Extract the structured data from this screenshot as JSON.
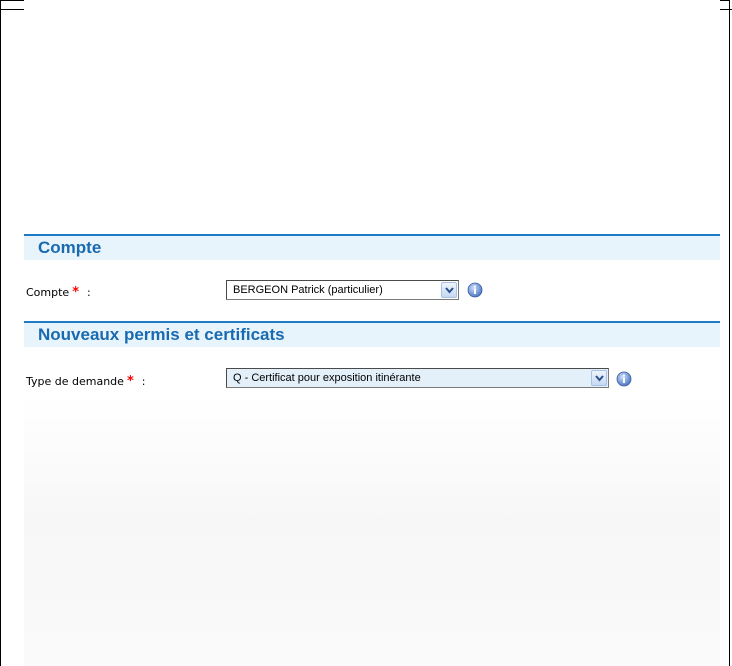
{
  "sections": {
    "compte": {
      "title": "Compte",
      "field_label": "Compte",
      "required_marker": "*",
      "colon": ":",
      "select_value": "BERGEON Patrick (particulier)"
    },
    "permis": {
      "title": "Nouveaux permis et certificats",
      "field_label": "Type de demande",
      "required_marker": "*",
      "colon": ":",
      "select_value": "Q - Certificat pour exposition itinérante"
    }
  },
  "icons": {
    "dropdown": "chevron-down-icon",
    "info": "info-icon"
  },
  "colors": {
    "accent": "#1a6aaf",
    "section_bg": "#e8f4fc",
    "required": "#ff0000",
    "select_highlight": "#e3f0fa"
  }
}
